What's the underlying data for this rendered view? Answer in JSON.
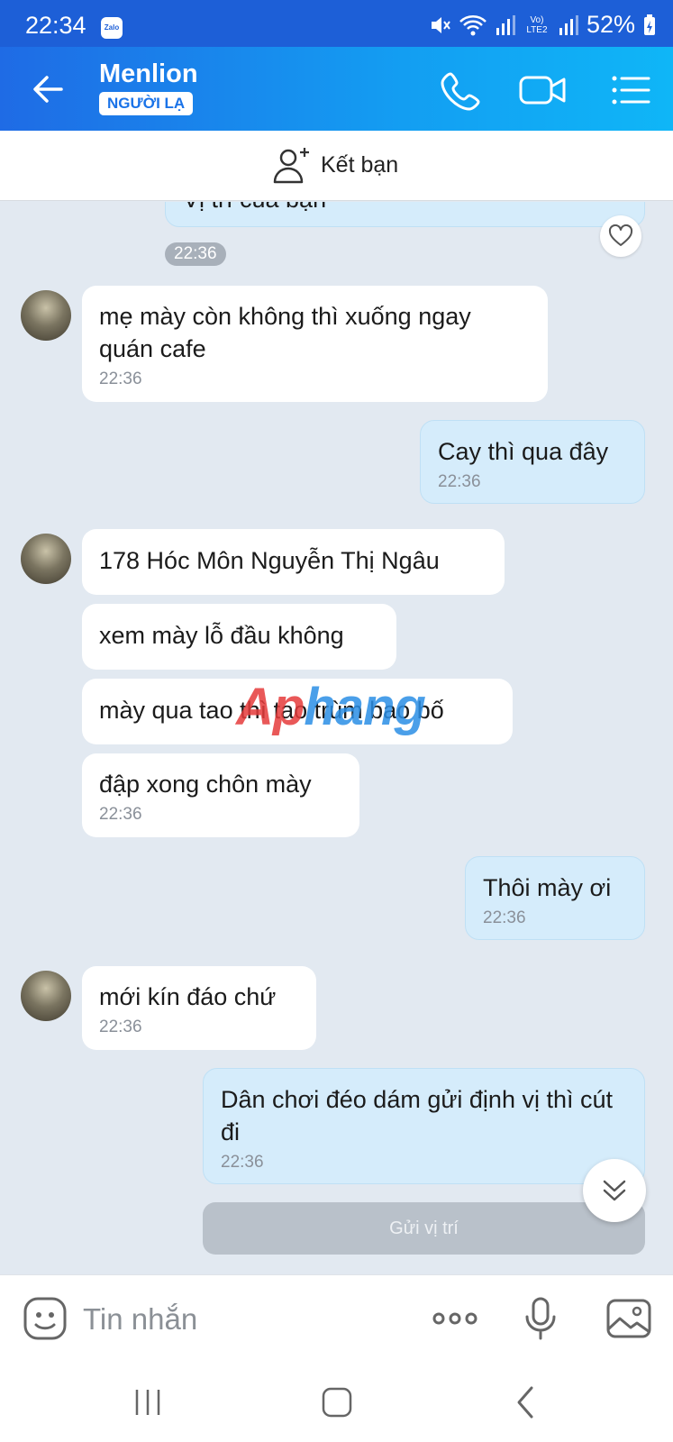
{
  "status_bar": {
    "time": "22:34",
    "app_badge": "Zalo",
    "network_label": "Vo) LTE2",
    "battery": "52%"
  },
  "header": {
    "contact_name": "Menlion",
    "contact_tag": "NGƯỜI LẠ",
    "icons": [
      "back-arrow-icon",
      "phone-icon",
      "video-call-icon",
      "menu-list-icon"
    ]
  },
  "add_friend": {
    "label": "Kết bạn"
  },
  "chat": {
    "partial_top_text": "Vị trí của bạn",
    "first_time_chip": "22:36",
    "messages": [
      {
        "dir": "in",
        "text": "mẹ mày còn không thì xuống ngay quán cafe",
        "time": "22:36"
      },
      {
        "dir": "out",
        "text": "Cay thì qua đây",
        "time": "22:36"
      },
      {
        "dir": "in",
        "text": "178 Hóc Môn Nguyễn Thị Ngâu",
        "time": ""
      },
      {
        "dir": "in",
        "text": "xem mày lỗ đầu không",
        "time": ""
      },
      {
        "dir": "in",
        "text": "mày qua tao thì tao trùm bao bố",
        "time": ""
      },
      {
        "dir": "in",
        "text": "đập xong chôn mày",
        "time": "22:36"
      },
      {
        "dir": "out",
        "text": "Thôi mày ơi",
        "time": "22:36"
      },
      {
        "dir": "in",
        "text": "mới kín đáo chứ",
        "time": "22:36"
      },
      {
        "dir": "out",
        "text": "Dân chơi đéo dám gửi định vị thì cút đi",
        "time": "22:36"
      }
    ],
    "send_location_label": "Gửi vị trí"
  },
  "watermark": {
    "part1": "Ap",
    "part2": "hang"
  },
  "composer": {
    "placeholder": "Tin nhắn"
  },
  "colors": {
    "header_start": "#1f6be5",
    "header_end": "#0fb6f7",
    "outgoing_bubble": "#d5ecfb",
    "incoming_bubble": "#ffffff",
    "chat_background": "#e2e9f1"
  }
}
